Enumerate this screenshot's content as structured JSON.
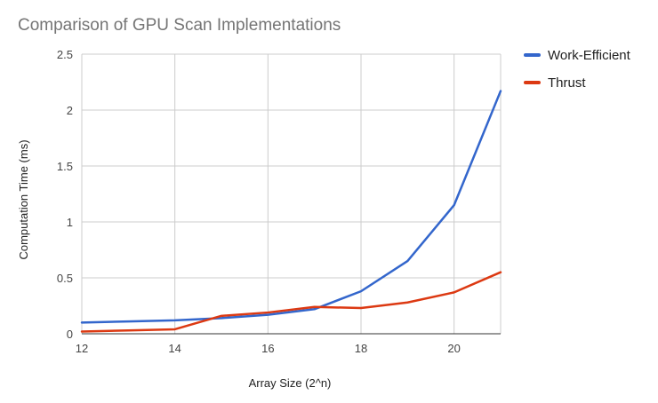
{
  "chart_data": {
    "type": "line",
    "title": "Comparison of GPU Scan Implementations",
    "xlabel": "Array Size (2^n)",
    "ylabel": "Computation Time (ms)",
    "x": [
      12,
      13,
      14,
      15,
      16,
      17,
      18,
      19,
      20,
      21
    ],
    "xlim": [
      12,
      21
    ],
    "x_ticks": [
      12,
      14,
      16,
      18,
      20
    ],
    "ylim": [
      0,
      2.5
    ],
    "y_ticks": [
      0,
      0.5,
      1,
      1.5,
      2,
      2.5
    ],
    "grid": true,
    "legend_position": "right",
    "series": [
      {
        "name": "Work-Efficient",
        "color": "#3366cc",
        "values": [
          0.1,
          0.11,
          0.12,
          0.14,
          0.17,
          0.22,
          0.38,
          0.65,
          1.15,
          2.17
        ]
      },
      {
        "name": "Thrust",
        "color": "#dc3912",
        "values": [
          0.02,
          0.03,
          0.04,
          0.16,
          0.19,
          0.24,
          0.23,
          0.28,
          0.37,
          0.55
        ]
      }
    ]
  }
}
